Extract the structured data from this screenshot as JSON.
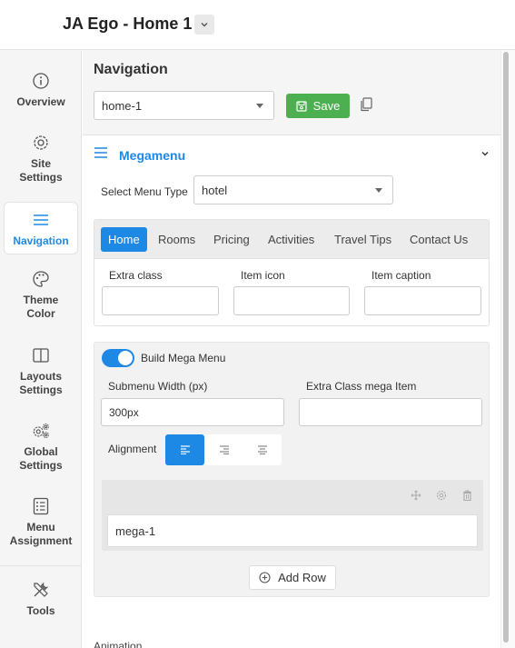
{
  "header": {
    "site_title": "JA Ego - Home 1"
  },
  "sidebar": {
    "items": [
      {
        "label": "Overview",
        "icon": "info-icon"
      },
      {
        "label": "Site Settings",
        "icon": "gear-icon"
      },
      {
        "label": "Navigation",
        "icon": "hamburger-icon",
        "active": true
      },
      {
        "label": "Theme Color",
        "icon": "palette-icon"
      },
      {
        "label": "Layouts Settings",
        "icon": "layout-icon"
      },
      {
        "label": "Global Settings",
        "icon": "gears-icon"
      },
      {
        "label": "Menu Assignment",
        "icon": "list-icon"
      },
      {
        "label": "Tools",
        "icon": "tools-icon"
      }
    ]
  },
  "navigation": {
    "title": "Navigation",
    "selected_menu": "home-1",
    "save_label": "Save"
  },
  "megamenu": {
    "title": "Megamenu",
    "menu_type_label": "Select Menu Type",
    "menu_type_value": "hotel",
    "tabs": [
      {
        "label": "Home",
        "active": true
      },
      {
        "label": "Rooms"
      },
      {
        "label": "Pricing"
      },
      {
        "label": "Activities"
      },
      {
        "label": "Travel Tips"
      },
      {
        "label": "Contact Us"
      }
    ],
    "fields": {
      "extra_class_label": "Extra class",
      "item_icon_label": "Item icon",
      "item_caption_label": "Item caption"
    },
    "build": {
      "toggle_label": "Build Mega Menu",
      "toggle_on": true,
      "submenu_width_label": "Submenu Width (px)",
      "submenu_width_value": "300px",
      "extra_class_mega_label": "Extra Class mega Item",
      "alignment_label": "Alignment",
      "alignment_selected": "left",
      "row_column": "mega-1",
      "add_row_label": "Add Row"
    },
    "animation_label": "Animation"
  },
  "colors": {
    "accent": "#1e88e5",
    "save": "#4caf50"
  }
}
